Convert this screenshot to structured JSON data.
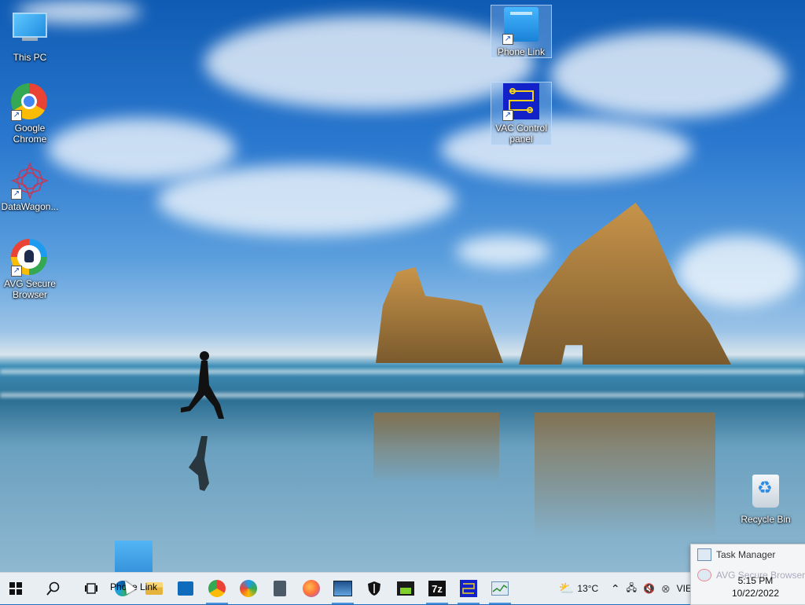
{
  "desktop": {
    "icons": [
      {
        "label": "This PC"
      },
      {
        "label": "Google Chrome"
      },
      {
        "label": "DataWagon..."
      },
      {
        "label": "AVG Secure Browser"
      },
      {
        "label": "Phone Link"
      },
      {
        "label": "VAC Control panel"
      },
      {
        "label": "Recycle Bin"
      }
    ],
    "drag_label": "Phone Link"
  },
  "taskbar": {
    "apps": [
      {
        "name": "search-icon"
      },
      {
        "name": "task-view-icon"
      },
      {
        "name": "edge-icon"
      },
      {
        "name": "file-explorer-icon"
      },
      {
        "name": "microsoft-store-icon"
      },
      {
        "name": "chrome-icon"
      },
      {
        "name": "avg-browser-icon"
      },
      {
        "name": "calculator-icon"
      },
      {
        "name": "firefox-icon"
      },
      {
        "name": "photos-icon"
      },
      {
        "name": "security-icon"
      },
      {
        "name": "app-icon"
      },
      {
        "name": "7zip-icon"
      },
      {
        "name": "vac-control-icon"
      },
      {
        "name": "task-manager-icon"
      }
    ],
    "sevenzip_label": "7z",
    "weather_temp": "13°C",
    "language": "VIE",
    "time": "5:15 PM",
    "date": "10/22/2022"
  },
  "jumplist": {
    "items": [
      {
        "label": "Task Manager"
      },
      {
        "label": "AVG Secure Browser"
      }
    ]
  }
}
